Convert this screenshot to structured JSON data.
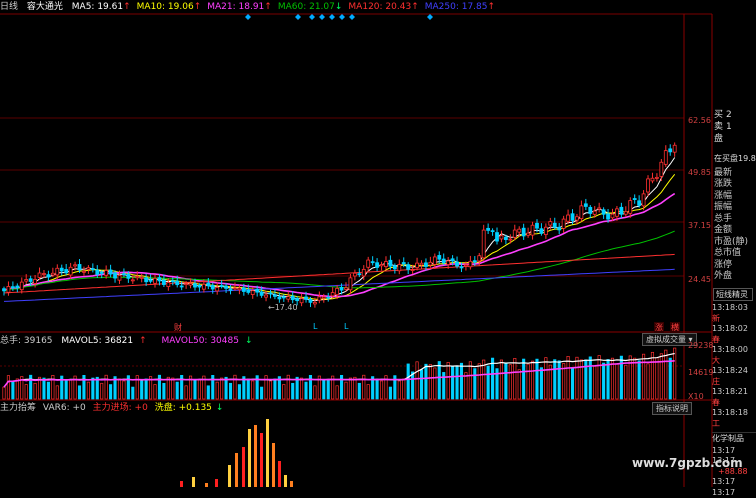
{
  "header": {
    "period_label": "日线",
    "indicator_name": "容大通光",
    "ma": [
      {
        "label": "MA5: 19.61",
        "color": "#ffffff",
        "arrow": "↑",
        "arrow_color": "#ff3030"
      },
      {
        "label": "MA10: 19.06",
        "color": "#ffff00",
        "arrow": "↑",
        "arrow_color": "#ff3030"
      },
      {
        "label": "MA21: 18.91",
        "color": "#ff40ff",
        "arrow": "↑",
        "arrow_color": "#ff3030"
      },
      {
        "label": "MA60: 21.07",
        "color": "#00c000",
        "arrow": "↓",
        "arrow_color": "#00ff60"
      },
      {
        "label": "MA120: 20.43",
        "color": "#ff3030",
        "arrow": "↑",
        "arrow_color": "#ff3030"
      },
      {
        "label": "MA250: 17.85",
        "color": "#4040ff",
        "arrow": "↑",
        "arrow_color": "#ff3030"
      }
    ],
    "diamond_color": "#00aaff"
  },
  "price_axis": [
    "62.56",
    "49.85",
    "37.15",
    "24.45"
  ],
  "price_low_marker": "17.40",
  "markers": {
    "cai": "财",
    "l1": "L",
    "l2": "L",
    "zhang": "涨",
    "heng": "横"
  },
  "volume": {
    "label_volume": "总手: 39165",
    "label_mavol5": "MAVOL5: 36821",
    "label_mavol50": "MAVOL50: 30485",
    "mavol5_arrow": "↑",
    "mavol50_arrow": "↓",
    "button_label": "虚拟成交量",
    "axis": [
      "29238",
      "14619",
      "X10"
    ]
  },
  "indicator": {
    "name": "主力抬筹",
    "var": "VAR6: +0",
    "zhuli": "主力进场: +0",
    "xipan": "洗盘: +0.135",
    "xipan_arrow": "↓",
    "button_label": "指标说明"
  },
  "side_panel": {
    "quote_labels": [
      "买",
      "卖",
      "盘"
    ],
    "quote_nums": [
      "2",
      "1"
    ],
    "inner_label": "在买盘19.87位",
    "fields": [
      "最新",
      "涨跌",
      "涨幅",
      "振幅",
      "总手",
      "金额",
      "市盈(静)",
      "总市值",
      "涨停",
      "外盘"
    ],
    "tab_label": "短线精灵",
    "ticks": [
      {
        "time": "13:18:03",
        "text": "新",
        "color": "#ff4040"
      },
      {
        "time": "13:18:02",
        "text": "春",
        "color": "#ff4040"
      },
      {
        "time": "13:18:00",
        "text": "大",
        "color": "#ff4040"
      },
      {
        "time": "13:18:24",
        "text": "庄",
        "color": "#ff4040"
      },
      {
        "time": "13:18:21",
        "text": "春",
        "color": "#ff4040"
      },
      {
        "time": "13:18:18",
        "text": "工",
        "color": "#ff4040"
      }
    ],
    "sector": "化学制品",
    "bottom_times": [
      {
        "time": "13:17",
        "text": ""
      },
      {
        "time": "13:17",
        "text": ""
      },
      {
        "time": "",
        "text": "+88.88"
      },
      {
        "time": "13:17",
        "text": ""
      },
      {
        "time": "13:17",
        "text": ""
      }
    ]
  },
  "watermark": "www.7gpzb.com",
  "chart_data": {
    "type": "candlestick",
    "panes": [
      "price",
      "volume",
      "indicator"
    ],
    "price_range": [
      17.4,
      62.56
    ],
    "ma_lines": [
      "MA5",
      "MA10",
      "MA21",
      "MA60",
      "MA120",
      "MA250"
    ],
    "volume_range": [
      0,
      29238
    ],
    "colors": {
      "up": "#ff3030",
      "down": "#00d0ff"
    }
  }
}
